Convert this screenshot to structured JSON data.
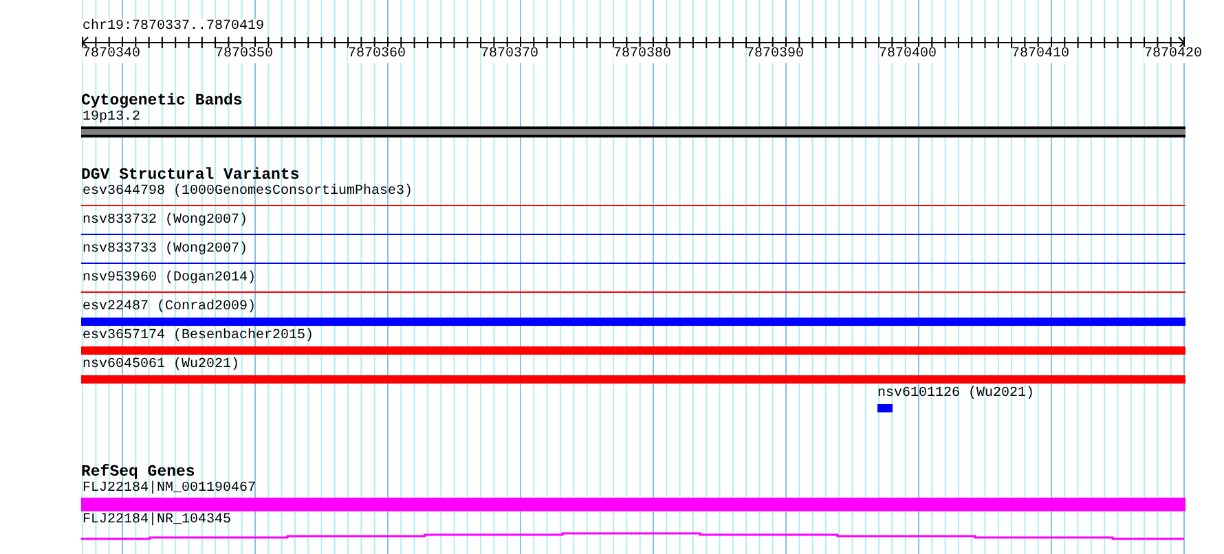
{
  "location": "chr19:7870337..7870419",
  "ruler": {
    "labels": [
      "7870340",
      "7870350",
      "7870360",
      "7870370",
      "7870380",
      "7870390",
      "7870400",
      "7870410",
      "7870420"
    ]
  },
  "tracks": [
    {
      "title": "Cytogenetic Bands",
      "features": [
        {
          "label": "19p13.2",
          "kind": "band"
        }
      ]
    },
    {
      "title": "DGV Structural Variants",
      "features": [
        {
          "label": "esv3644798 (1000GenomesConsortiumPhase3)",
          "kind": "line",
          "color": "#ff0000"
        },
        {
          "label": "nsv833732 (Wong2007)",
          "kind": "line",
          "color": "#0000ff"
        },
        {
          "label": "nsv833733 (Wong2007)",
          "kind": "line",
          "color": "#0000ff"
        },
        {
          "label": "nsv953960 (Dogan2014)",
          "kind": "line",
          "color": "#ff0000"
        },
        {
          "label": "esv22487 (Conrad2009)",
          "kind": "bar",
          "color": "#0000ff"
        },
        {
          "label": "esv3657174 (Besenbacher2015)",
          "kind": "bar",
          "color": "#ff0000"
        },
        {
          "label": "nsv6045061 (Wu2021)",
          "kind": "bar",
          "color": "#ff0000"
        },
        {
          "label": "nsv6101126 (Wu2021)",
          "kind": "block",
          "color": "#0000ff"
        }
      ]
    },
    {
      "title": "RefSeq Genes",
      "features": [
        {
          "label": "FLJ22184|NM_001190467",
          "kind": "thick"
        },
        {
          "label": "FLJ22184|NR_104345",
          "kind": "wavy"
        }
      ]
    }
  ]
}
